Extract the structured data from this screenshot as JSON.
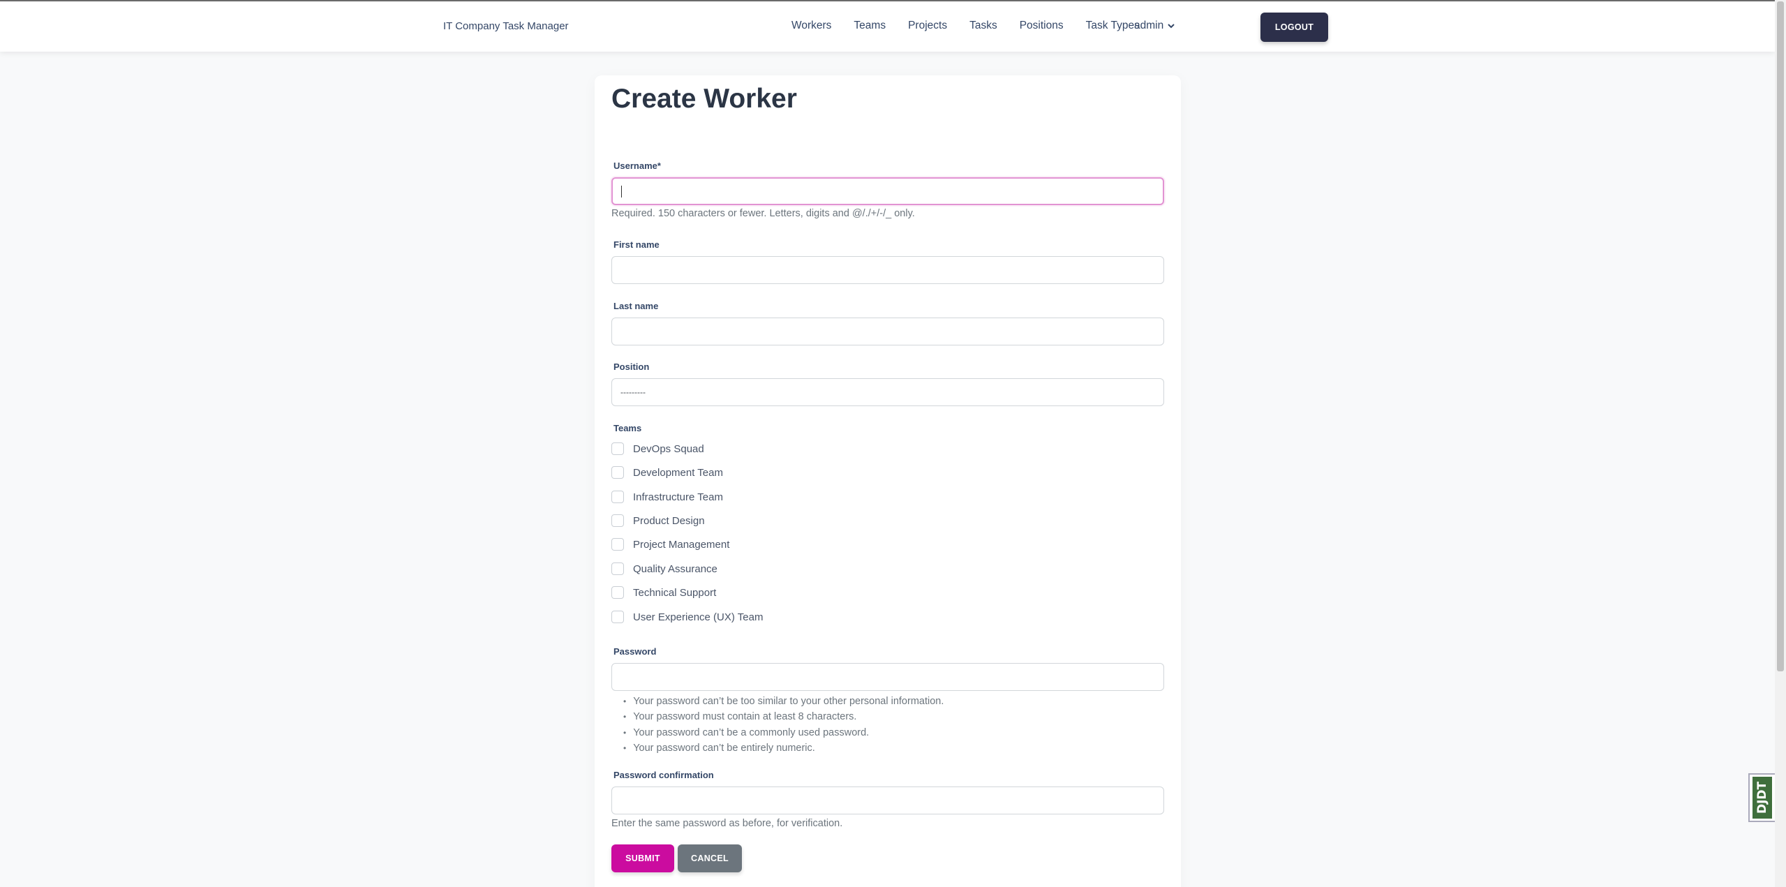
{
  "navbar": {
    "brand": "IT Company Task Manager",
    "links": [
      "Workers",
      "Teams",
      "Projects",
      "Tasks",
      "Positions",
      "Task Types"
    ],
    "user": "admin",
    "logout": "LOGOUT"
  },
  "form": {
    "title": "Create Worker",
    "username_label": "Username*",
    "username_value": "",
    "username_help": "Required. 150 characters or fewer. Letters, digits and @/./+/-/_ only.",
    "first_name_label": "First name",
    "last_name_label": "Last name",
    "position_label": "Position",
    "position_selected": "---------",
    "teams_label": "Teams",
    "teams": [
      "DevOps Squad",
      "Development Team",
      "Infrastructure Team",
      "Product Design",
      "Project Management",
      "Quality Assurance",
      "Technical Support",
      "User Experience (UX) Team"
    ],
    "password_label": "Password",
    "password_help": [
      "Your password can’t be too similar to your other personal information.",
      "Your password must contain at least 8 characters.",
      "Your password can’t be a commonly used password.",
      "Your password can’t be entirely numeric."
    ],
    "password_confirm_label": "Password confirmation",
    "password_confirm_help": "Enter the same password as before, for verification.",
    "submit": "SUBMIT",
    "cancel": "CANCEL"
  },
  "toolbar": {
    "djdt_label": "DJDT"
  },
  "colors": {
    "accent": "#cb0c9f",
    "dark_button": "#2c2f4a",
    "cancel_button": "#6c757d",
    "focus_border": "#e293d3"
  }
}
